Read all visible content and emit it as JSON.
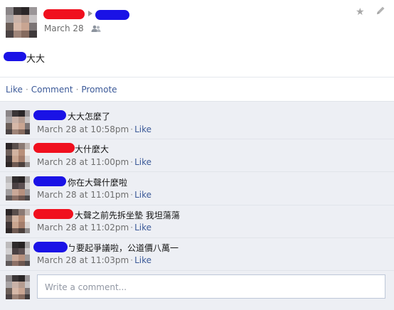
{
  "post": {
    "date": "March 28",
    "text_suffix": "大大",
    "star_icon": "star-icon",
    "edit_icon": "pencil-icon",
    "audience_icon": "friends-icon"
  },
  "actions": {
    "like": "Like",
    "comment": "Comment",
    "promote": "Promote",
    "separator": "·"
  },
  "comments": [
    {
      "text": "大大怎麼了",
      "time": "March 28 at 10:58pm",
      "like": "Like"
    },
    {
      "text": "大什麼大",
      "time": "March 28 at 11:00pm",
      "like": "Like"
    },
    {
      "text": "你在大聲什麼啦",
      "time": "March 28 at 11:01pm",
      "like": "Like"
    },
    {
      "text": "大聲之前先拆坐墊 我坦蕩蕩",
      "time": "March 28 at 11:02pm",
      "like": "Like"
    },
    {
      "text": "ㄅ要起爭議啦，公道價八萬一",
      "time": "March 28 at 11:03pm",
      "like": "Like"
    }
  ],
  "composer": {
    "placeholder": "Write a comment..."
  },
  "colors": {
    "link": "#3b5998",
    "redaction_blue": "#1a12e6",
    "redaction_red": "#f0101e",
    "panel_bg": "#edeff4"
  }
}
